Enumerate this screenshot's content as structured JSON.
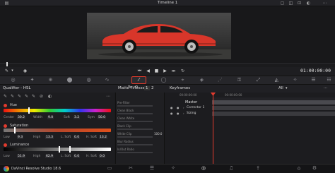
{
  "timeline_title": "Timeline 1",
  "timecode": "01:00:00:00",
  "sub_bar": {
    "qualifier_title": "Qualifier - HSL",
    "matte_finesse": "Matte Finesse",
    "matte_page": "1",
    "matte_page_2": "2",
    "keyframes": "Keyframes",
    "filter": "All"
  },
  "hue": {
    "label": "Hue",
    "fields": [
      {
        "label": "Center",
        "value": "30.2"
      },
      {
        "label": "Width",
        "value": "9.0"
      },
      {
        "label": "Soft",
        "value": "3.2"
      },
      {
        "label": "Sym",
        "value": "50.0"
      }
    ]
  },
  "saturation": {
    "label": "Saturation",
    "fields": [
      {
        "label": "Low",
        "value": "9.3"
      },
      {
        "label": "High",
        "value": "13.3"
      },
      {
        "label": "L. Soft",
        "value": "0.0"
      },
      {
        "label": "H. Soft",
        "value": "13.2"
      }
    ]
  },
  "luminance": {
    "label": "Luminance",
    "fields": [
      {
        "label": "Low",
        "value": "51.9"
      },
      {
        "label": "High",
        "value": "62.9"
      },
      {
        "label": "L. Soft",
        "value": "0.0"
      },
      {
        "label": "H. Soft",
        "value": "0.0"
      }
    ]
  },
  "matte_params": [
    {
      "label": "Pre-Filter",
      "value": ""
    },
    {
      "label": "Clean Black",
      "value": ""
    },
    {
      "label": "Clean White",
      "value": ""
    },
    {
      "label": "Black Clip",
      "value": ""
    },
    {
      "label": "White Clip",
      "value": "100.0"
    },
    {
      "label": "Blur Radius",
      "value": ""
    },
    {
      "label": "In/Out Ratio",
      "value": ""
    }
  ],
  "keyframes": {
    "ruler_start": "00:00:00:00",
    "ruler_mid": "00:00:00:00",
    "rows": [
      {
        "label": "Master"
      },
      {
        "label": "Corrector 1"
      },
      {
        "label": "Sizing"
      }
    ]
  },
  "app_name": "DaVinci Resolve Studio 18.6",
  "colors": {
    "accent_red": "#e23b2e",
    "car_red": "#d8362a"
  },
  "icons": {
    "picker_active": "eyedropper-icon"
  }
}
